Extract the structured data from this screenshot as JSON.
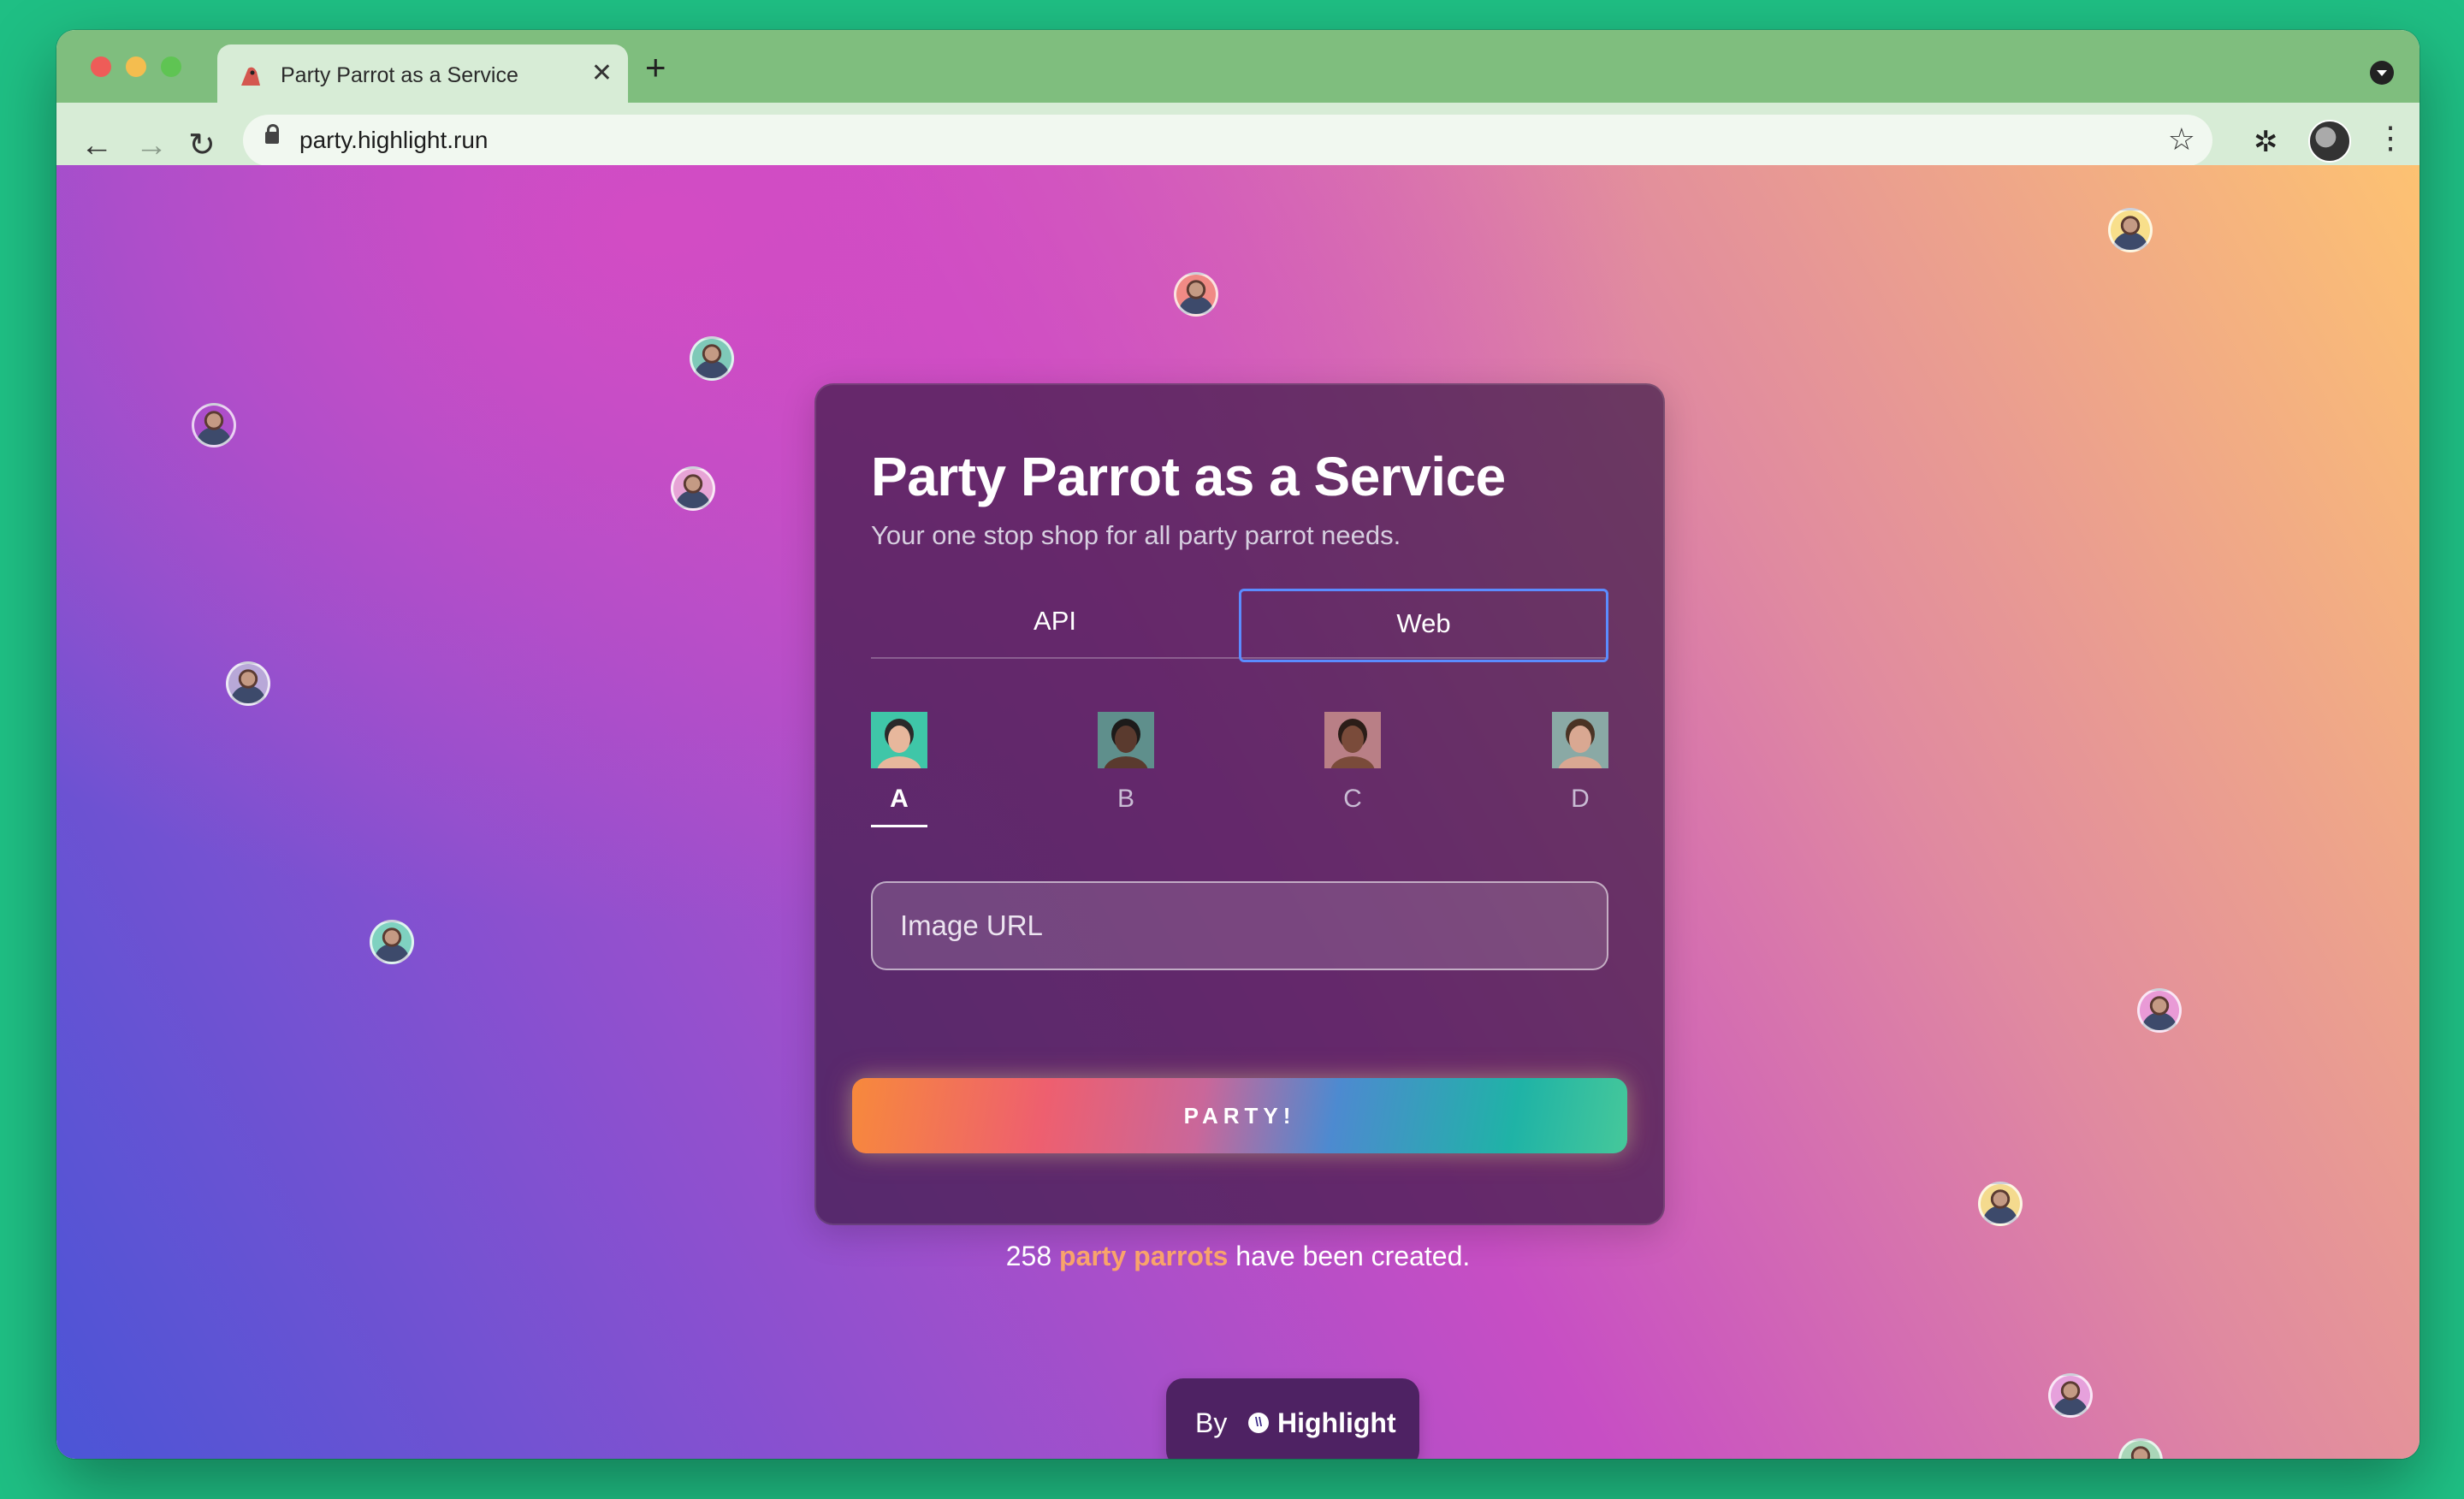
{
  "browser": {
    "tab_title": "Party Parrot as a Service",
    "tab_close": "✕",
    "new_tab": "+",
    "url": "party.highlight.run",
    "nav": {
      "back": "←",
      "forward": "→",
      "reload": "↻"
    },
    "icons": {
      "bookmark": "☆",
      "extensions": "✲",
      "menu": "⋮"
    }
  },
  "card": {
    "title": "Party Parrot as a Service",
    "subtitle": "Your one stop shop for all party parrot needs.",
    "tabs": [
      {
        "label": "API",
        "active": false
      },
      {
        "label": "Web",
        "active": true
      }
    ],
    "faces": [
      {
        "label": "A",
        "active": true,
        "bg": "#3fc6a8",
        "skin": "#e7b79c",
        "hair": "#2a2a2a"
      },
      {
        "label": "B",
        "active": false,
        "bg": "#5f8f8c",
        "skin": "#5a3a2e",
        "hair": "#1d1b1a"
      },
      {
        "label": "C",
        "active": false,
        "bg": "#b97f86",
        "skin": "#7a4b3a",
        "hair": "#2b1d18"
      },
      {
        "label": "D",
        "active": false,
        "bg": "#8aa9a5",
        "skin": "#d9a892",
        "hair": "#4a3324"
      }
    ],
    "image_url_placeholder": "Image URL",
    "party_button": "PARTY!"
  },
  "counter": {
    "count": "258",
    "highlight": "party parrots",
    "suffix": "have been created."
  },
  "byline": {
    "by": "By",
    "brand": "Highlight",
    "logo_glyph": "\\\\"
  },
  "colors": {
    "page_bg": "#1fbf84",
    "tab_strip": "#7fbe7e",
    "active_tab_outline": "#5b8cff",
    "counter_highlight": "#f9a36b",
    "byline_bg": "#4e2263"
  }
}
